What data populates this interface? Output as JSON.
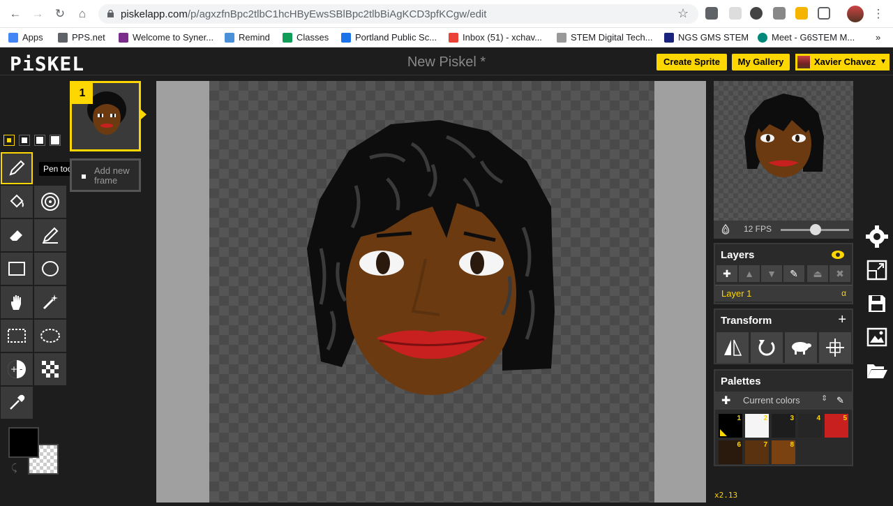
{
  "browser": {
    "url_domain": "piskelapp.com",
    "url_path": "/p/agxzfnBpc2tlbC1hcHByEwsSBlBpc2tlbBiAgKCD3pfKCgw/edit",
    "bookmarks": [
      "Apps",
      "PPS.net",
      "Welcome to Syner...",
      "Remind",
      "Classes",
      "Portland Public Sc...",
      "Inbox (51) - xchav...",
      "STEM Digital Tech...",
      "NGS GMS STEM",
      "Meet - G6STEM M..."
    ],
    "more_bookmarks": "»"
  },
  "app": {
    "logo": "PiSKEL",
    "title": "New Piskel *",
    "create_sprite": "Create Sprite",
    "my_gallery": "My Gallery",
    "user_name": "Xavier Chavez"
  },
  "tools": {
    "tooltip": "Pen tool (P)"
  },
  "frames": {
    "frame_number": "1",
    "add_frame": "Add new frame"
  },
  "preview": {
    "fps_label": "12 FPS",
    "fps": 12,
    "fps_max": 24
  },
  "layers": {
    "title": "Layers",
    "layer_name": "Layer 1",
    "alpha_symbol": "α"
  },
  "transform": {
    "title": "Transform"
  },
  "palettes": {
    "title": "Palettes",
    "current": "Current colors",
    "swatches": [
      {
        "num": "1",
        "color": "#000000"
      },
      {
        "num": "2",
        "color": "#f5f5f5"
      },
      {
        "num": "3",
        "color": "#1d1d1d"
      },
      {
        "num": "4",
        "color": "#262626"
      },
      {
        "num": "5",
        "color": "#c8201e"
      },
      {
        "num": "6",
        "color": "#2a1a0e"
      },
      {
        "num": "7",
        "color": "#5a3210"
      },
      {
        "num": "8",
        "color": "#7a4210"
      }
    ]
  },
  "status": {
    "zoom": "x2.13"
  },
  "colors": {
    "accent": "#ffd700",
    "skin": "#6b3a10",
    "hair": "#0d0d0d",
    "hair_highlight": "#3a3a3a",
    "lips": "#c8201e"
  }
}
